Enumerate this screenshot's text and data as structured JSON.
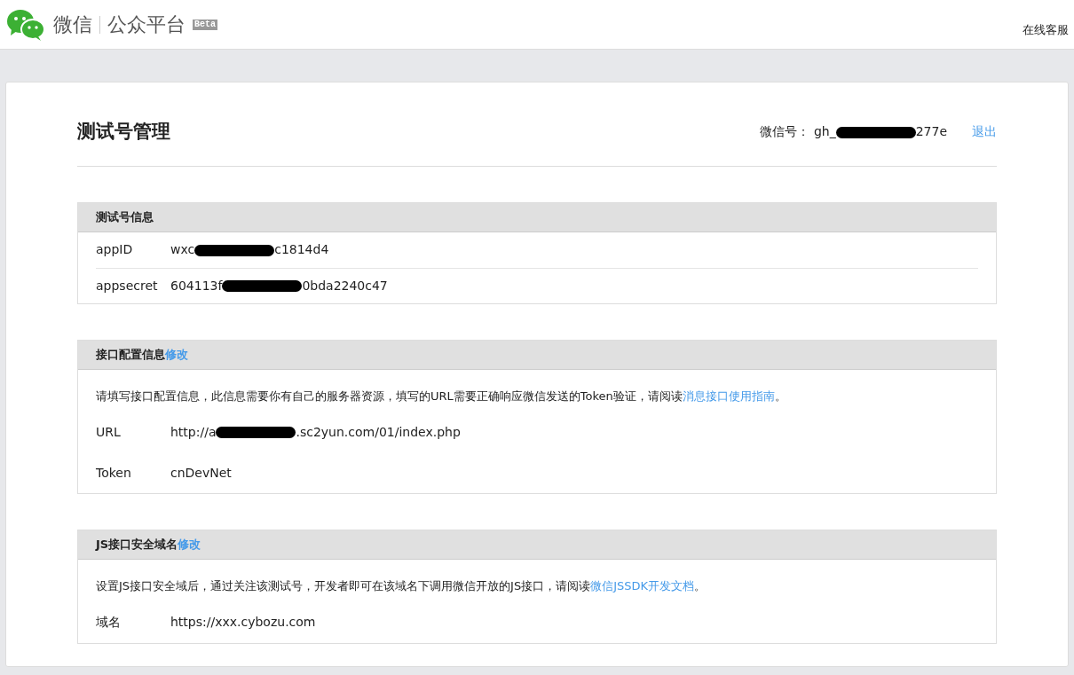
{
  "header": {
    "brand": "微信",
    "product": "公众平台",
    "badge": "Beta",
    "service_link": "在线客服"
  },
  "page": {
    "title": "测试号管理",
    "account_label": "微信号：",
    "account_parts": [
      "gh_",
      "277e"
    ],
    "logout": "退出"
  },
  "sections": [
    {
      "title": "测试号信息",
      "rows": [
        {
          "label": "appID",
          "parts": [
            "wxc",
            "c1814d4"
          ]
        },
        {
          "label": "appsecret",
          "parts": [
            "604113f",
            "0bda2240c47"
          ]
        }
      ]
    },
    {
      "title": "接口配置信息",
      "edit": "修改",
      "description": {
        "before": "请填写接口配置信息，此信息需要你有自己的服务器资源，填写的URL需要正确响应微信发送的Token验证，请阅读",
        "link": "消息接口使用指南",
        "after": "。"
      },
      "rows": [
        {
          "label": "URL",
          "parts": [
            "http://a",
            ".sc2yun.com/01/index.php"
          ]
        },
        {
          "label": "Token",
          "parts": [
            "cnDevNet"
          ]
        }
      ]
    },
    {
      "title": "JS接口安全域名",
      "edit": "修改",
      "description": {
        "before": "设置JS接口安全域后，通过关注该测试号，开发者即可在该域名下调用微信开放的JS接口，请阅读",
        "link": "微信JSSDK开发文档",
        "after": "。"
      },
      "rows": [
        {
          "label": "域名",
          "parts": [
            "https://xxx.cybozu.com"
          ]
        }
      ]
    }
  ]
}
